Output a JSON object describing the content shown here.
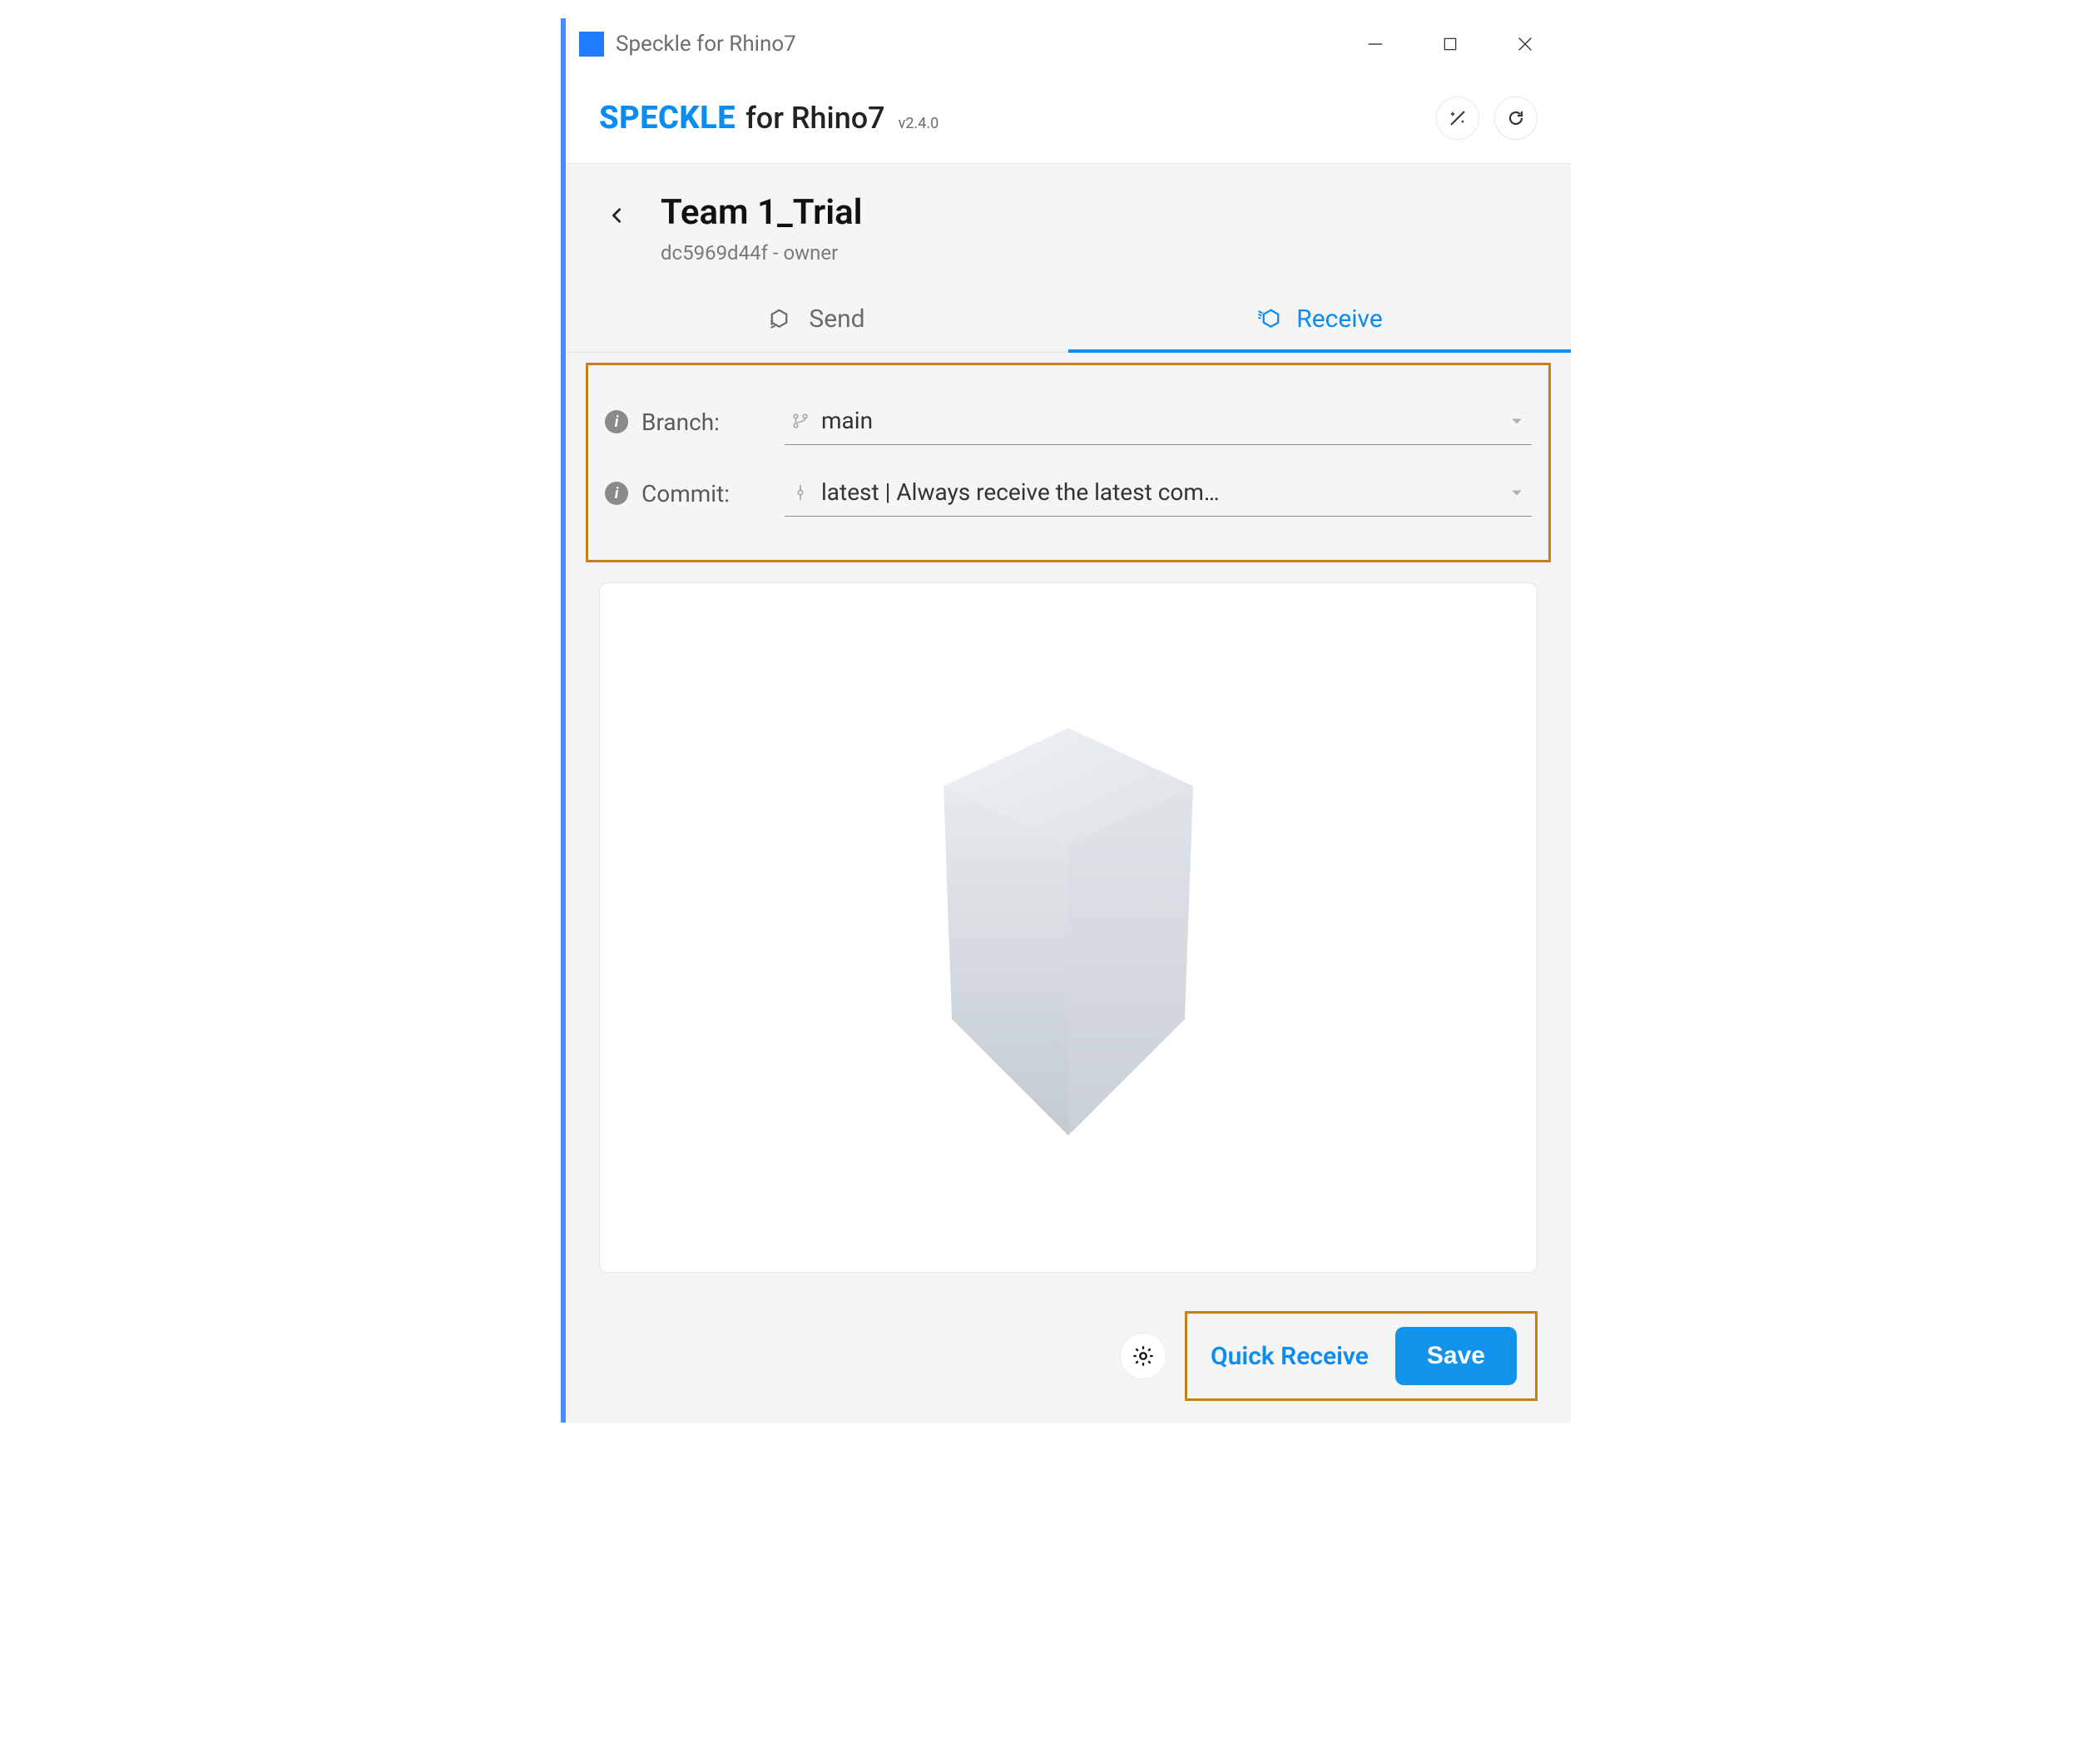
{
  "titlebar": {
    "title": "Speckle for Rhino7"
  },
  "header": {
    "brand_main": "SPECKLE",
    "brand_for": "for Rhino7",
    "version": "v2.4.0"
  },
  "stream": {
    "title": "Team 1_Trial",
    "meta": "dc5969d44f - owner"
  },
  "tabs": {
    "send": "Send",
    "receive": "Receive"
  },
  "form": {
    "branch_label": "Branch:",
    "branch_value": "main",
    "commit_label": "Commit:",
    "commit_value": "latest | Always receive the latest com…"
  },
  "footer": {
    "quick": "Quick Receive",
    "save": "Save"
  }
}
